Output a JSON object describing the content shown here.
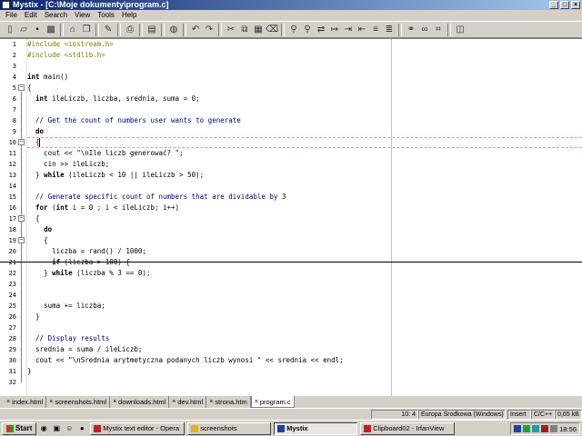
{
  "window": {
    "title": "Mystix - [C:\\Moje dokumenty\\program.c]"
  },
  "menu": [
    "File",
    "Edit",
    "Search",
    "View",
    "Tools",
    "Help"
  ],
  "toolbar_icons": [
    "new-file-icon",
    "open-file-icon",
    "save-icon",
    "save-all-icon",
    "separator",
    "open-folder-icon",
    "copy-file-icon",
    "separator",
    "wand-icon",
    "separator",
    "print-icon",
    "separator",
    "document-icon",
    "separator",
    "globe-icon",
    "separator",
    "undo-icon",
    "redo-icon",
    "separator",
    "cut-icon",
    "copy-icon",
    "paste-icon",
    "delete-icon",
    "separator",
    "find-icon",
    "find-next-icon",
    "replace-icon",
    "goto-icon",
    "indent-icon",
    "outdent-icon",
    "comment-icon",
    "uncomment-icon",
    "separator",
    "find-in-files-icon",
    "binoculars-icon",
    "tag-icon",
    "separator",
    "window-icon"
  ],
  "code": [
    [
      {
        "t": "pp",
        "s": "#include <iostream.h>"
      }
    ],
    [
      {
        "t": "pp",
        "s": "#include <stdlib.h>"
      }
    ],
    [],
    [
      {
        "t": "kw",
        "s": "int"
      },
      {
        "t": "n",
        "s": " main()"
      }
    ],
    [
      {
        "t": "n",
        "s": "{"
      }
    ],
    [
      {
        "t": "n",
        "s": "  "
      },
      {
        "t": "kw",
        "s": "int"
      },
      {
        "t": "n",
        "s": " ileLiczb, liczba, srednia, suma = 0;"
      }
    ],
    [],
    [
      {
        "t": "cm",
        "s": "  // Get the count of numbers user wants to generate"
      }
    ],
    [
      {
        "t": "n",
        "s": "  "
      },
      {
        "t": "kw",
        "s": "do"
      }
    ],
    [
      {
        "t": "n",
        "s": "  {"
      }
    ],
    [
      {
        "t": "n",
        "s": "    cout << "
      },
      {
        "t": "str",
        "s": "\"\\nIle liczb generować? \""
      },
      {
        "t": "n",
        "s": ";"
      }
    ],
    [
      {
        "t": "n",
        "s": "    cin >> ileLiczb;"
      }
    ],
    [
      {
        "t": "n",
        "s": "  } "
      },
      {
        "t": "kw",
        "s": "while"
      },
      {
        "t": "n",
        "s": " (ileLiczb < 10 || ileLiczb > 50);"
      }
    ],
    [],
    [
      {
        "t": "cm",
        "s": "  // Generate specific count of numbers that are dividable by 3"
      }
    ],
    [
      {
        "t": "n",
        "s": "  "
      },
      {
        "t": "kw",
        "s": "for"
      },
      {
        "t": "n",
        "s": " ("
      },
      {
        "t": "kw",
        "s": "int"
      },
      {
        "t": "n",
        "s": " i = 0 ; i < ileLiczb; i++)"
      }
    ],
    [
      {
        "t": "n",
        "s": "  {"
      }
    ],
    [
      {
        "t": "n",
        "s": "    "
      },
      {
        "t": "kw",
        "s": "do"
      }
    ],
    [
      {
        "t": "n",
        "s": "    {"
      }
    ],
    [
      {
        "t": "n",
        "s": "      liczba = rand() / 1000;"
      }
    ],
    [
      {
        "t": "n",
        "s": "      "
      },
      {
        "t": "kw",
        "s": "if"
      },
      {
        "t": "n",
        "s": " (liczba > 100) {"
      }
    ],
    [
      {
        "t": "n",
        "s": "    } "
      },
      {
        "t": "kw",
        "s": "while"
      },
      {
        "t": "n",
        "s": " (liczba % 3 == 0);"
      }
    ],
    [],
    [
      {
        "t": "n",
        "s": "    suma += liczba;"
      }
    ],
    [
      {
        "t": "n",
        "s": "  }"
      }
    ],
    [],
    [
      {
        "t": "cm",
        "s": "  // Display results"
      }
    ],
    [
      {
        "t": "n",
        "s": "  srednia = suma / ileLiczb;"
      }
    ],
    [
      {
        "t": "n",
        "s": "  cout << "
      },
      {
        "t": "str",
        "s": "\"\\nSrednia arytmetyczna podanych liczb wynosi \""
      },
      {
        "t": "n",
        "s": " << srednia << endl;"
      }
    ],
    [
      {
        "t": "n",
        "s": "}"
      }
    ]
  ],
  "line_numbers": [
    "1",
    "2",
    "3",
    "4",
    "5",
    "6",
    "7",
    "8",
    "9",
    "10",
    "11",
    "12",
    "13",
    "14",
    "15",
    "16",
    "17",
    "18",
    "19",
    "20",
    "21",
    "22",
    "23",
    "24",
    "25",
    "26",
    "27",
    "28",
    "29",
    "30",
    "31",
    "32"
  ],
  "tabs": [
    {
      "label": "index.html",
      "active": false
    },
    {
      "label": "screenshots.html",
      "active": false
    },
    {
      "label": "downloads.html",
      "active": false
    },
    {
      "label": "dev.html",
      "active": false
    },
    {
      "label": "strona.htm",
      "active": false
    },
    {
      "label": "program.c",
      "active": true
    }
  ],
  "status": {
    "position": "10: 4",
    "encoding": "Europa Środkowa (Windows)",
    "mode": "Insert",
    "language": "C/C++",
    "size": "0,65 kB"
  },
  "taskbar": {
    "start_label": "Start",
    "tasks": [
      {
        "label": "Mystix text editor - Opera",
        "active": false,
        "color": "#c02020"
      },
      {
        "label": "screenshots",
        "active": false,
        "color": "#e0b030"
      },
      {
        "label": "Mystix",
        "active": true,
        "color": "#2040a0"
      },
      {
        "label": "Clipboard02 - IrfanView",
        "active": false,
        "color": "#c02020"
      }
    ],
    "clock": "18:56"
  }
}
